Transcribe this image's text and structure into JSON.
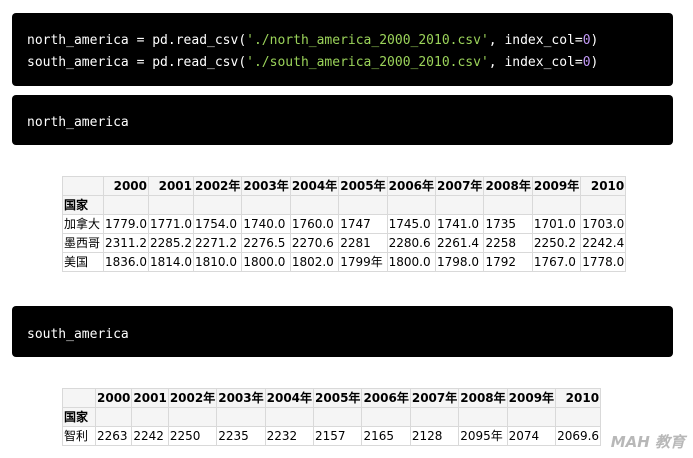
{
  "code_cells": [
    {
      "lines": [
        {
          "var": "north_america",
          "op": " = pd.read_csv(",
          "str": "'./north_america_2000_2010.csv'",
          "mid": ", index_col=",
          "num": "0",
          "end": ")"
        },
        {
          "var": "south_america",
          "op": " = pd.read_csv(",
          "str": "'./south_america_2000_2010.csv'",
          "mid": ", index_col=",
          "num": "0",
          "end": ")"
        }
      ]
    },
    {
      "text": "north_america"
    },
    {
      "text": "south_america"
    }
  ],
  "table_north": {
    "headers": [
      "",
      "2000",
      "2001",
      "2002年",
      "2003年",
      "2004年",
      "2005年",
      "2006年",
      "2007年",
      "2008年",
      "2009年",
      "2010"
    ],
    "index_name": "国家",
    "rows": [
      [
        "加拿大",
        "1779.0",
        "1771.0",
        "1754.0",
        "1740.0",
        "1760.0",
        "1747",
        "1745.0",
        "1741.0",
        "1735",
        "1701.0",
        "1703.0"
      ],
      [
        "墨西哥",
        "2311.2",
        "2285.2",
        "2271.2",
        "2276.5",
        "2270.6",
        "2281",
        "2280.6",
        "2261.4",
        "2258",
        "2250.2",
        "2242.4"
      ],
      [
        "美国",
        "1836.0",
        "1814.0",
        "1810.0",
        "1800.0",
        "1802.0",
        "1799年",
        "1800.0",
        "1798.0",
        "1792",
        "1767.0",
        "1778.0"
      ]
    ]
  },
  "table_south": {
    "headers": [
      "",
      "2000",
      "2001",
      "2002年",
      "2003年",
      "2004年",
      "2005年",
      "2006年",
      "2007年",
      "2008年",
      "2009年",
      "2010"
    ],
    "index_name": "国家",
    "rows": [
      [
        "智利",
        "2263",
        "2242",
        "2250",
        "2235",
        "2232",
        "2157",
        "2165",
        "2128",
        "2095年",
        "2074",
        "2069.6"
      ]
    ]
  },
  "watermark": "MAH 教育"
}
